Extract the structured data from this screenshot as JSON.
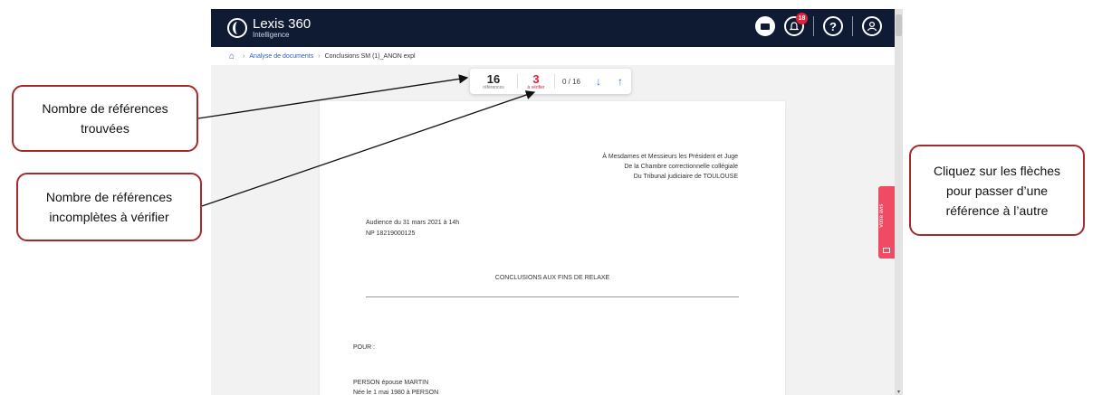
{
  "app": {
    "logo_name": "Lexis 360",
    "logo_sub": "Intelligence",
    "notification_count": "18",
    "help_icon": "?"
  },
  "breadcrumb": {
    "home_icon": "home-icon",
    "items": [
      "Analyse de documents",
      "Conclusions SM (1)_ANON expl"
    ]
  },
  "references": {
    "found_count": "16",
    "found_label": "références",
    "verify_count": "3",
    "verify_label": "à vérifier",
    "position": "0 / 16",
    "next_icon": "arrow-down-icon",
    "prev_icon": "arrow-up-icon"
  },
  "document": {
    "addressee": [
      "À Mesdames et Messieurs les Président et Juge",
      "De la Chambre correctionnelle collégiale",
      "Du Tribunal judiciaire de TOULOUSE"
    ],
    "hearing": [
      "Audience du 31 mars 2021 à 14h",
      "NP 18219000125"
    ],
    "title": "CONCLUSIONS AUX FINS DE RELAXE",
    "pour": "POUR :",
    "person": [
      "PERSON épouse MARTIN",
      "Née le 1 mai 1980 à PERSON"
    ]
  },
  "feedback_tab": "Votre avis",
  "callouts": {
    "found": [
      "Nombre de références",
      "trouvées"
    ],
    "verify": [
      "Nombre de références",
      "incomplètes à vérifier"
    ],
    "arrows": [
      "Cliquez sur les flèches",
      "pour passer d’une",
      "référence à l’autre"
    ]
  },
  "colors": {
    "topbar": "#0f1b33",
    "accent_red": "#e0213a",
    "link_blue": "#2b5fb4",
    "callout_border": "#a32b2b"
  }
}
